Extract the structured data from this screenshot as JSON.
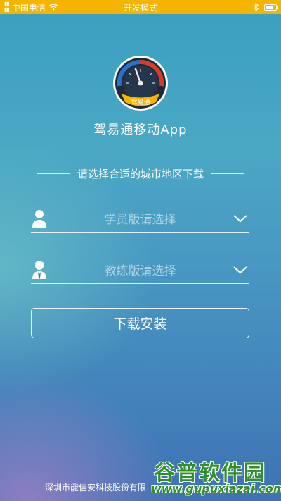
{
  "status_bar": {
    "carrier": "中国电信",
    "mode": "开发模式"
  },
  "app": {
    "logo_text": "驾易通",
    "name": "驾易通移动App"
  },
  "section": {
    "title": "请选择合适的城市地区下载"
  },
  "fields": {
    "student": {
      "placeholder": "学员版请选择",
      "icon": "person-icon"
    },
    "coach": {
      "placeholder": "教练版请选择",
      "icon": "coach-icon"
    }
  },
  "actions": {
    "install_label": "下载安装"
  },
  "footer": {
    "company": "深圳市能信安科技股份有限"
  },
  "watermark": {
    "title": "谷普软件园",
    "url": "www.gupuxiazai.com"
  },
  "colors": {
    "status_bar": "#f5b400",
    "watermark": "#2f8f2a"
  }
}
